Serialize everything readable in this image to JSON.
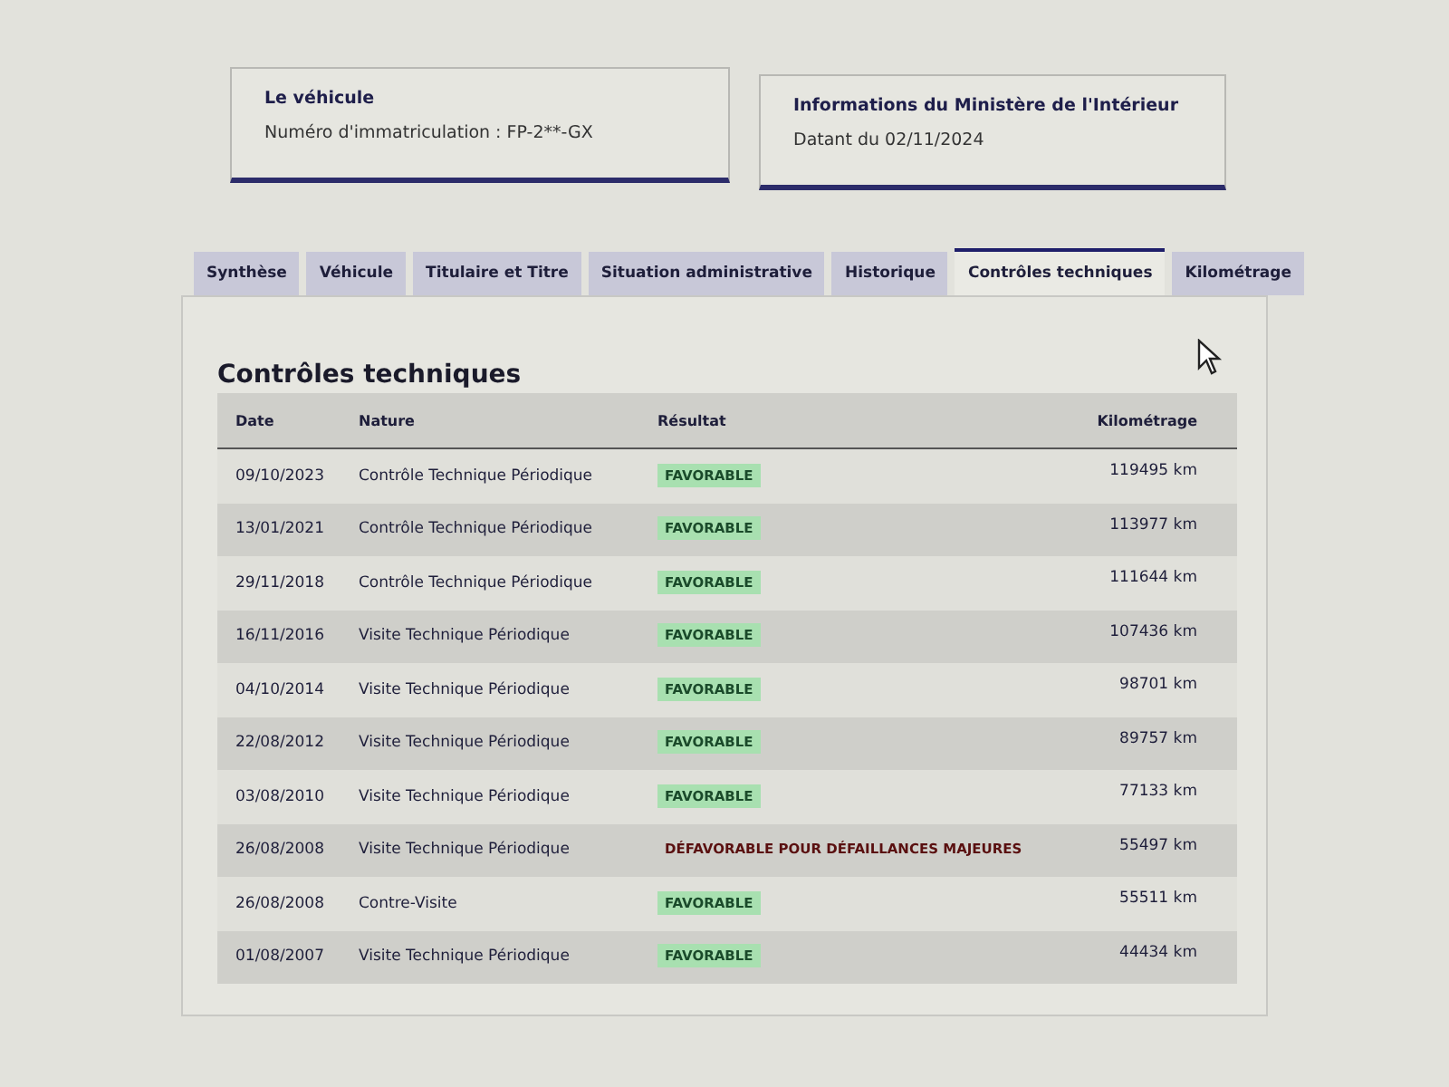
{
  "cards": [
    {
      "title": "Le véhicule",
      "text": "Numéro d'immatriculation : FP-2**-GX"
    },
    {
      "title": "Informations du Ministère de l'Intérieur",
      "text": "Datant du 02/11/2024"
    }
  ],
  "tabs": [
    {
      "label": "Synthèse",
      "selected": false
    },
    {
      "label": "Véhicule",
      "selected": false
    },
    {
      "label": "Titulaire et Titre",
      "selected": false
    },
    {
      "label": "Situation administrative",
      "selected": false
    },
    {
      "label": "Historique",
      "selected": false
    },
    {
      "label": "Contrôles techniques",
      "selected": true
    },
    {
      "label": "Kilométrage",
      "selected": false
    }
  ],
  "section_title": "Contrôles techniques",
  "table": {
    "columns": [
      "Date",
      "Nature",
      "Résultat",
      "Kilométrage"
    ],
    "rows": [
      {
        "date": "09/10/2023",
        "nature": "Contrôle Technique Périodique",
        "result": "FAVORABLE",
        "kind": "favorable",
        "mileage": "119495 km"
      },
      {
        "date": "13/01/2021",
        "nature": "Contrôle Technique Périodique",
        "result": "FAVORABLE",
        "kind": "favorable",
        "mileage": "113977 km"
      },
      {
        "date": "29/11/2018",
        "nature": "Contrôle Technique Périodique",
        "result": "FAVORABLE",
        "kind": "favorable",
        "mileage": "111644 km"
      },
      {
        "date": "16/11/2016",
        "nature": "Visite Technique Périodique",
        "result": "FAVORABLE",
        "kind": "favorable",
        "mileage": "107436 km"
      },
      {
        "date": "04/10/2014",
        "nature": "Visite Technique Périodique",
        "result": "FAVORABLE",
        "kind": "favorable",
        "mileage": "98701 km"
      },
      {
        "date": "22/08/2012",
        "nature": "Visite Technique Périodique",
        "result": "FAVORABLE",
        "kind": "favorable",
        "mileage": "89757 km"
      },
      {
        "date": "03/08/2010",
        "nature": "Visite Technique Périodique",
        "result": "FAVORABLE",
        "kind": "favorable",
        "mileage": "77133 km"
      },
      {
        "date": "26/08/2008",
        "nature": "Visite Technique Périodique",
        "result": "DÉFAVORABLE POUR DÉFAILLANCES MAJEURES",
        "kind": "defavorable",
        "mileage": "55497 km"
      },
      {
        "date": "26/08/2008",
        "nature": "Contre-Visite",
        "result": "FAVORABLE",
        "kind": "favorable",
        "mileage": "55511 km"
      },
      {
        "date": "01/08/2007",
        "nature": "Visite Technique Périodique",
        "result": "FAVORABLE",
        "kind": "favorable",
        "mileage": "44434 km"
      }
    ]
  }
}
